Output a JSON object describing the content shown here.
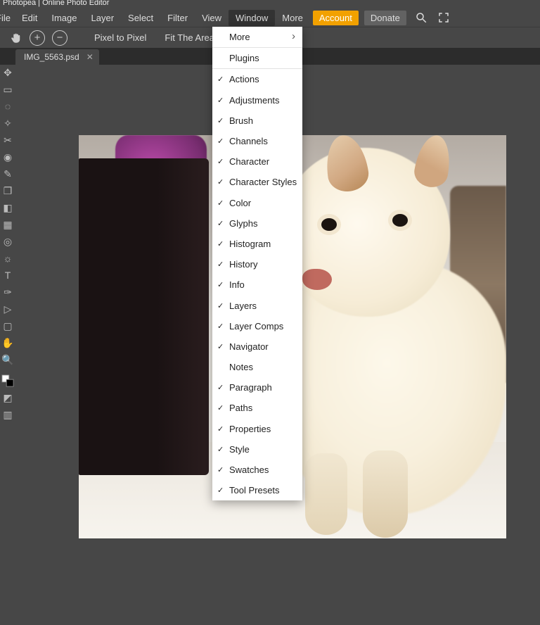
{
  "title": "Photopea | Online Photo Editor",
  "menu": {
    "items": [
      "File",
      "Edit",
      "Image",
      "Layer",
      "Select",
      "Filter",
      "View",
      "Window",
      "More"
    ],
    "active": "Window",
    "account": "Account",
    "donate": "Donate"
  },
  "options": {
    "pixel_to_pixel": "Pixel to Pixel",
    "fit_the_area": "Fit The Area",
    "checkbox_checked": true
  },
  "tab": {
    "filename": "IMG_5563.psd"
  },
  "dropdown": {
    "top": [
      {
        "label": "More",
        "arrow": true
      },
      {
        "label": "Plugins"
      }
    ],
    "checked_items": [
      "Actions",
      "Adjustments",
      "Brush",
      "Channels",
      "Character",
      "Character Styles",
      "Color",
      "Glyphs",
      "Histogram",
      "History",
      "Info",
      "Layers",
      "Layer Comps",
      "Navigator"
    ],
    "unchecked_then": [
      {
        "label": "Notes",
        "checked": false
      },
      {
        "label": "Paragraph",
        "checked": true
      },
      {
        "label": "Paths",
        "checked": true
      },
      {
        "label": "Properties",
        "checked": true
      },
      {
        "label": "Style",
        "checked": true
      },
      {
        "label": "Swatches",
        "checked": true
      },
      {
        "label": "Tool Presets",
        "checked": true
      }
    ]
  }
}
